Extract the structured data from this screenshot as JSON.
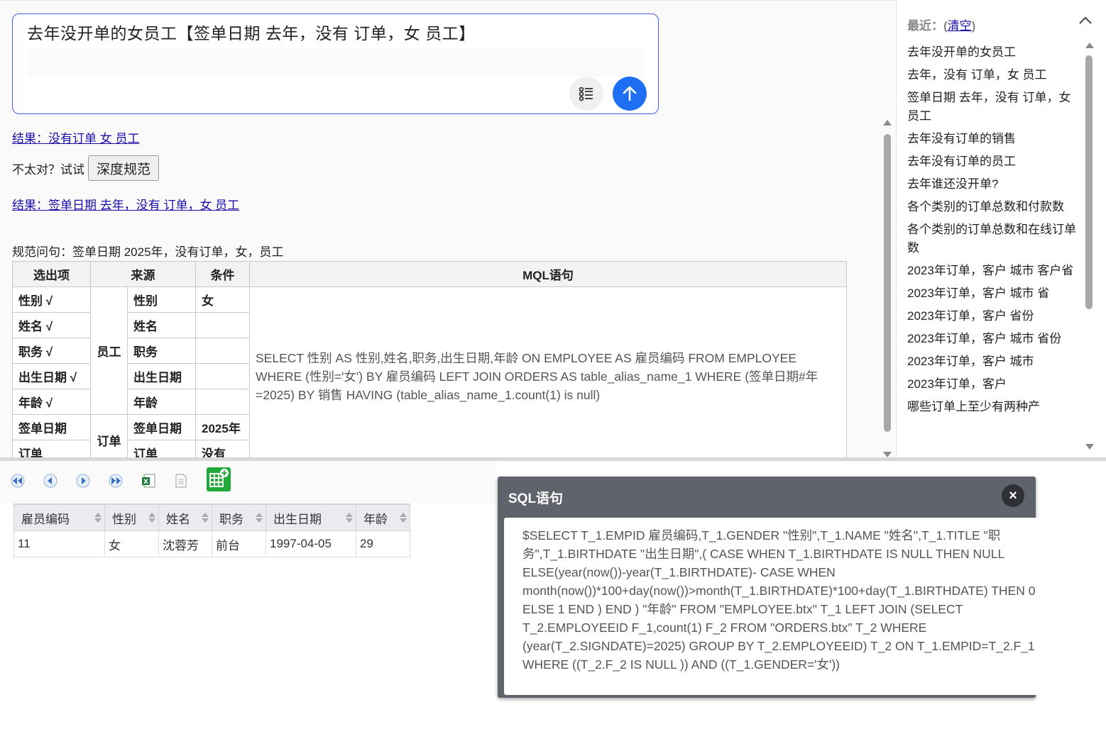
{
  "query": {
    "text": "去年没开单的女员工【签单日期  去年，没有  订单，女  员工】"
  },
  "result_links": [
    "结果：没有订单 女 员工",
    "结果：签单日期 去年，没有 订单，女 员工"
  ],
  "retry": {
    "prompt": "不太对？试试",
    "button": "深度规范"
  },
  "normalized": "规范问句：签单日期 2025年，没有订单，女，员工",
  "mql_table": {
    "headers": [
      "选出项",
      "来源",
      "条件",
      "MQL语句"
    ],
    "rows": [
      {
        "select": "性别 √",
        "field": "性别",
        "cond": "女"
      },
      {
        "select": "姓名 √",
        "field": "姓名",
        "cond": ""
      },
      {
        "select": "职务 √",
        "field": "职务",
        "cond": ""
      },
      {
        "select": "出生日期 √",
        "field": "出生日期",
        "cond": ""
      },
      {
        "select": "年龄 √",
        "field": "年龄",
        "cond": ""
      },
      {
        "select": "签单日期",
        "field": "签单日期",
        "cond": "2025年"
      },
      {
        "select": "订单",
        "field": "订单",
        "cond": "没有"
      }
    ],
    "source_employee": "员工",
    "source_orders": "订单",
    "mql": "SELECT 性别 AS 性别,姓名,职务,出生日期,年龄 ON EMPLOYEE AS 雇员编码 FROM EMPLOYEE WHERE (性别='女') BY 雇员编码 LEFT JOIN ORDERS AS table_alias_name_1 WHERE (签单日期#年=2025) BY 销售 HAVING (table_alias_name_1.count(1) is null)"
  },
  "recent": {
    "label": "最近：(",
    "clear": "清空",
    "close_paren": ")",
    "items": [
      "去年没开单的女员工",
      "去年，没有 订单，女 员工",
      "签单日期 去年，没有 订单，女 员工",
      "去年没有订单的销售",
      "去年没有订单的员工",
      "去年谁还没开单?",
      "各个类别的订单总数和付款数",
      "各个类别的订单总数和在线订单数",
      "2023年订单，客户 城市 客户省",
      "2023年订单，客户 城市 省",
      "2023年订单，客户 省份",
      "2023年订单，客户 城市 省份",
      "2023年订单，客户 城市",
      "2023年订单，客户",
      "哪些订单上至少有两种产"
    ]
  },
  "result_table": {
    "headers": [
      "雇员编码",
      "性别",
      "姓名",
      "职务",
      "出生日期",
      "年龄"
    ],
    "rows": [
      [
        "11",
        "女",
        "沈蓉芳",
        "前台",
        "1997-04-05",
        "29"
      ]
    ]
  },
  "sql_modal": {
    "title": "SQL语句",
    "close": "×",
    "sql": "$SELECT T_1.EMPID 雇员编码,T_1.GENDER \"性别\",T_1.NAME \"姓名\",T_1.TITLE \"职务\",T_1.BIRTHDATE \"出生日期\",( CASE WHEN T_1.BIRTHDATE IS NULL THEN NULL ELSE(year(now())-year(T_1.BIRTHDATE)- CASE WHEN month(now())*100+day(now())>month(T_1.BIRTHDATE)*100+day(T_1.BIRTHDATE) THEN 0 ELSE 1 END ) END ) \"年龄\" FROM \"EMPLOYEE.btx\" T_1 LEFT JOIN (SELECT T_2.EMPLOYEEID F_1,count(1) F_2 FROM \"ORDERS.btx\" T_2 WHERE (year(T_2.SIGNDATE)=2025) GROUP BY T_2.EMPLOYEEID) T_2 ON T_1.EMPID=T_2.F_1 WHERE ((T_2.F_2 IS NULL )) AND ((T_1.GENDER='女'))"
  },
  "colors": {
    "accent": "#1f6ff5",
    "border": "#4a5cf0",
    "modal": "#5f636b"
  }
}
